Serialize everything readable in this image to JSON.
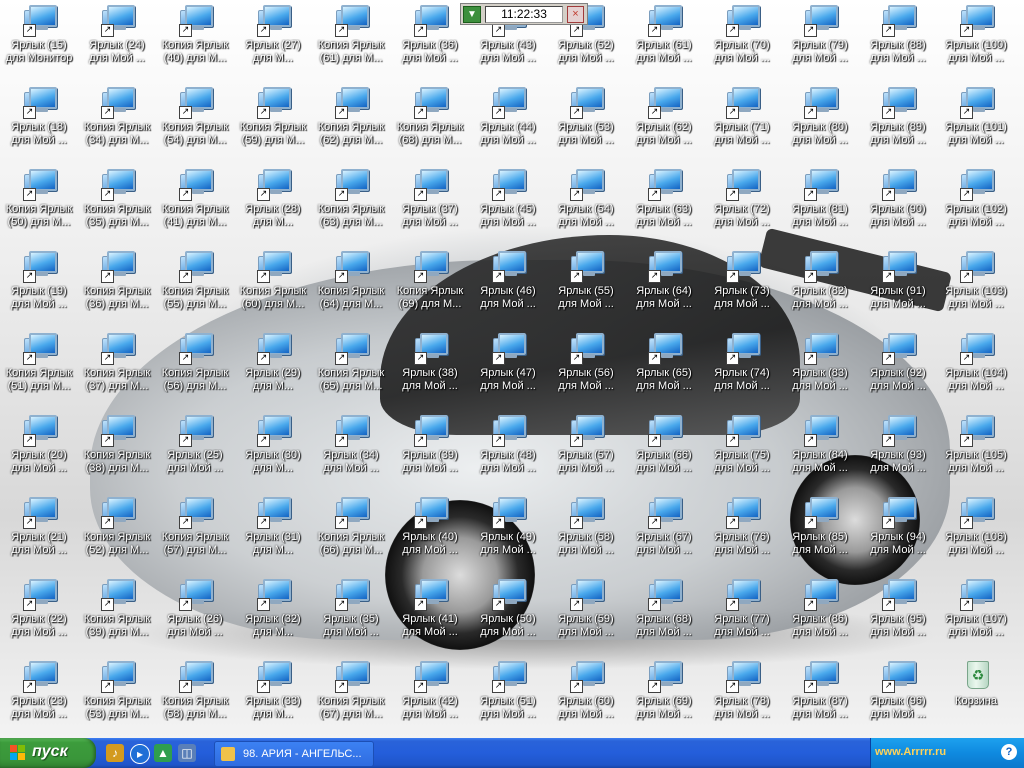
{
  "desktop": {
    "icons": [
      {
        "label": "Ярлык (15) для Монитор"
      },
      {
        "label": "Ярлык (24) для Мой ..."
      },
      {
        "label": "Копия Ярлык (40) для М..."
      },
      {
        "label": "Ярлык (27) для М..."
      },
      {
        "label": "Копия Ярлык (61) для М..."
      },
      {
        "label": "Ярлык (36) для Мой ..."
      },
      {
        "label": "Ярлык (43) для Мой ..."
      },
      {
        "label": "Ярлык (52) для Мой ..."
      },
      {
        "label": "Ярлык (61) для Мой ..."
      },
      {
        "label": "Ярлык (70) для Мой ..."
      },
      {
        "label": "Ярлык (79) для Мой ..."
      },
      {
        "label": "Ярлык (88) для Мой ..."
      },
      {
        "label": "Ярлык (100) для Мой ..."
      },
      {
        "label": "Ярлык (18) для Мой ..."
      },
      {
        "label": "Копия Ярлык (34) для М..."
      },
      {
        "label": "Копия Ярлык (54) для М..."
      },
      {
        "label": "Копия Ярлык (59) для М..."
      },
      {
        "label": "Копия Ярлык (62) для М..."
      },
      {
        "label": "Копия Ярлык (68) для М..."
      },
      {
        "label": "Ярлык (44) для Мой ..."
      },
      {
        "label": "Ярлык (53) для Мой ..."
      },
      {
        "label": "Ярлык (62) для Мой ..."
      },
      {
        "label": "Ярлык (71) для Мой ..."
      },
      {
        "label": "Ярлык (80) для Мой ..."
      },
      {
        "label": "Ярлык (89) для Мой ..."
      },
      {
        "label": "Ярлык (101) для Мой ..."
      },
      {
        "label": "Копия Ярлык (50) для М..."
      },
      {
        "label": "Копия Ярлык (35) для М..."
      },
      {
        "label": "Копия Ярлык (41) для М..."
      },
      {
        "label": "Ярлык (28) для М..."
      },
      {
        "label": "Копия Ярлык (63) для М..."
      },
      {
        "label": "Ярлык (37) для Мой ..."
      },
      {
        "label": "Ярлык (45) для Мой ..."
      },
      {
        "label": "Ярлык (54) для Мой ..."
      },
      {
        "label": "Ярлык (63) для Мой ..."
      },
      {
        "label": "Ярлык (72) для Мой ..."
      },
      {
        "label": "Ярлык (81) для Мой ..."
      },
      {
        "label": "Ярлык (90) для Мой ..."
      },
      {
        "label": "Ярлык (102) для Мой ..."
      },
      {
        "label": "Ярлык (19) для Мой ..."
      },
      {
        "label": "Копия Ярлык (36) для М..."
      },
      {
        "label": "Копия Ярлык (55) для М..."
      },
      {
        "label": "Копия Ярлык (60) для М..."
      },
      {
        "label": "Копия Ярлык (64) для М..."
      },
      {
        "label": "Копия Ярлык (69) для М..."
      },
      {
        "label": "Ярлык (46) для Мой ..."
      },
      {
        "label": "Ярлык (55) для Мой ..."
      },
      {
        "label": "Ярлык (64) для Мой ..."
      },
      {
        "label": "Ярлык (73) для Мой ..."
      },
      {
        "label": "Ярлык (82) для Мой ..."
      },
      {
        "label": "Ярлык (91) для Мой ..."
      },
      {
        "label": "Ярлык (103) для Мой ..."
      },
      {
        "label": "Копия Ярлык (51) для М..."
      },
      {
        "label": "Копия Ярлык (37) для М..."
      },
      {
        "label": "Копия Ярлык (56) для М..."
      },
      {
        "label": "Ярлык (29) для М..."
      },
      {
        "label": "Копия Ярлык (65) для М..."
      },
      {
        "label": "Ярлык (38) для Мой ..."
      },
      {
        "label": "Ярлык (47) для Мой ..."
      },
      {
        "label": "Ярлык (56) для Мой ..."
      },
      {
        "label": "Ярлык (65) для Мой ..."
      },
      {
        "label": "Ярлык (74) для Мой ..."
      },
      {
        "label": "Ярлык (83) для Мой ..."
      },
      {
        "label": "Ярлык (92) для Мой ..."
      },
      {
        "label": "Ярлык (104) для Мой ..."
      },
      {
        "label": "Ярлык (20) для Мой ..."
      },
      {
        "label": "Копия Ярлык (38) для М..."
      },
      {
        "label": "Ярлык (25) для Мой ..."
      },
      {
        "label": "Ярлык (30) для М..."
      },
      {
        "label": "Ярлык (34) для Мой ..."
      },
      {
        "label": "Ярлык (39) для Мой ..."
      },
      {
        "label": "Ярлык (48) для Мой ..."
      },
      {
        "label": "Ярлык (57) для Мой ..."
      },
      {
        "label": "Ярлык (66) для Мой ..."
      },
      {
        "label": "Ярлык (75) для Мой ..."
      },
      {
        "label": "Ярлык (84) для Мой ..."
      },
      {
        "label": "Ярлык (93) для Мой ..."
      },
      {
        "label": "Ярлык (105) для Мой ..."
      },
      {
        "label": "Ярлык (21) для Мой ..."
      },
      {
        "label": "Копия Ярлык (52) для М..."
      },
      {
        "label": "Копия Ярлык (57) для М..."
      },
      {
        "label": "Ярлык (31) для М..."
      },
      {
        "label": "Копия Ярлык (66) для М..."
      },
      {
        "label": "Ярлык (40) для Мой ..."
      },
      {
        "label": "Ярлык (49) для Мой ..."
      },
      {
        "label": "Ярлык (58) для Мой ..."
      },
      {
        "label": "Ярлык (67) для Мой ..."
      },
      {
        "label": "Ярлык (76) для Мой ..."
      },
      {
        "label": "Ярлык (85) для Мой ..."
      },
      {
        "label": "Ярлык (94) для Мой ..."
      },
      {
        "label": "Ярлык (106) для Мой ..."
      },
      {
        "label": "Ярлык (22) для Мой ..."
      },
      {
        "label": "Копия Ярлык (39) для М..."
      },
      {
        "label": "Ярлык (26) для Мой ..."
      },
      {
        "label": "Ярлык (32) для М..."
      },
      {
        "label": "Ярлык (35) для Мой ..."
      },
      {
        "label": "Ярлык (41) для Мой ..."
      },
      {
        "label": "Ярлык (50) для Мой ..."
      },
      {
        "label": "Ярлык (59) для Мой ..."
      },
      {
        "label": "Ярлык (68) для Мой ..."
      },
      {
        "label": "Ярлык (77) для Мой ..."
      },
      {
        "label": "Ярлык (86) для Мой ..."
      },
      {
        "label": "Ярлык (95) для Мой ..."
      },
      {
        "label": "Ярлык (107) для Мой ..."
      },
      {
        "label": "Ярлык (23) для Мой ..."
      },
      {
        "label": "Копия Ярлык (53) для М..."
      },
      {
        "label": "Копия Ярлык (58) для М..."
      },
      {
        "label": "Ярлык (33) для М..."
      },
      {
        "label": "Копия Ярлык (67) для М..."
      },
      {
        "label": "Ярлык (42) для Мой ..."
      },
      {
        "label": "Ярлык (51) для Мой ..."
      },
      {
        "label": "Ярлык (60) для Мой ..."
      },
      {
        "label": "Ярлык (69) для Мой ..."
      },
      {
        "label": "Ярлык (78) для Мой ..."
      },
      {
        "label": "Ярлык (87) для Мой ..."
      },
      {
        "label": "Ярлык (96) для Мой ..."
      },
      {
        "label": "Корзина",
        "icon": "recycle-bin-icon"
      }
    ]
  },
  "clock": {
    "time": "11:22:33"
  },
  "taskbar": {
    "start_label": "пуск",
    "task_label": "98. АРИЯ - АНГЕЛЬС...",
    "tray_text": "www.Arrrrr.ru"
  },
  "colors": {
    "taskbar": "#245edb",
    "start": "#3c9c3c",
    "tray": "#0f8ae0"
  }
}
